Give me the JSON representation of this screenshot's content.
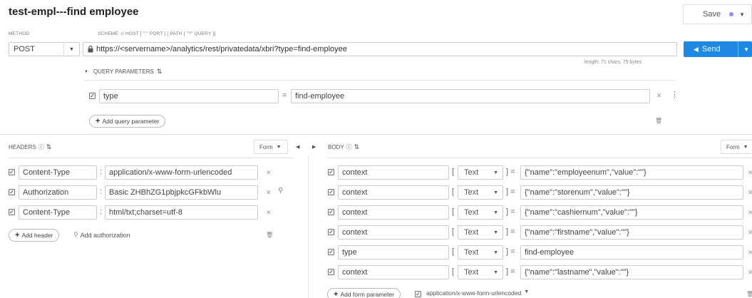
{
  "title": "test-empl---find employee",
  "save": {
    "label": "Save"
  },
  "method": {
    "label": "METHOD",
    "value": "POST"
  },
  "scheme": {
    "label": "SCHEME :// HOST [ \":\" PORT ] [ PATH [ \"?\" QUERY ]]"
  },
  "url": {
    "value": "https://<servername>/analytics/rest/privatedata/xbri?type=find-employee"
  },
  "send": {
    "label": "Send"
  },
  "length_info": "length: 71 chars, 75 bytes",
  "query": {
    "title": "QUERY PARAMETERS",
    "params": [
      {
        "name": "type",
        "value": "find-employee"
      }
    ],
    "add_label": "Add query parameter"
  },
  "headers": {
    "title": "HEADERS",
    "mode": "Form",
    "items": [
      {
        "name": "Content-Type",
        "value": "application/x-www-form-urlencoded"
      },
      {
        "name": "Authorization",
        "value": "Basic ZHBhZG1pbjpkcGFkbWlu"
      },
      {
        "name": "Content-Type",
        "value": "html/txt;charset=utf-8"
      }
    ],
    "add_label": "Add header",
    "auth_label": "Add authorization"
  },
  "body": {
    "title": "BODY",
    "mode": "Form",
    "items": [
      {
        "name": "context",
        "type": "Text",
        "value": "{\"name\":\"employeenum\",\"value\":\"\"}"
      },
      {
        "name": "context",
        "type": "Text",
        "value": "{\"name\":\"storenum\",\"value\":\"\"}"
      },
      {
        "name": "context",
        "type": "Text",
        "value": "{\"name\":\"cashiernum\",\"value\":\"\"}"
      },
      {
        "name": "context",
        "type": "Text",
        "value": "{\"name\":\"firstname\",\"value\":\"\"}"
      },
      {
        "name": "type",
        "type": "Text",
        "value": "find-employee"
      },
      {
        "name": "context",
        "type": "Text",
        "value": "{\"name\":\"lastname\",\"value\":\"\"}"
      }
    ],
    "add_label": "Add form parameter",
    "encoding": "application/x-www-form-urlencoded"
  },
  "colors": {
    "accent": "#1e88e5",
    "dot": "#8a8ff5"
  }
}
